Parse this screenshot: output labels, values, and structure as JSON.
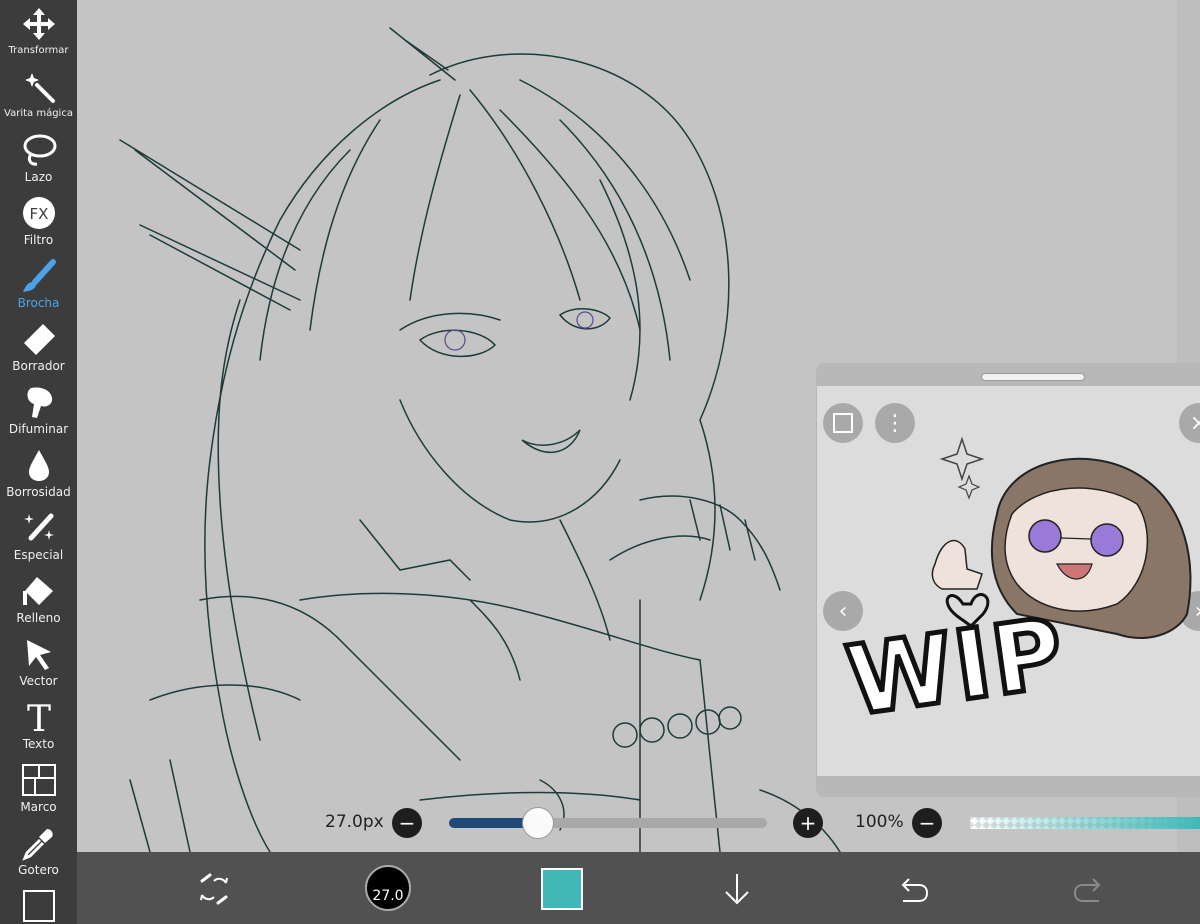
{
  "toolbar": {
    "tools": [
      {
        "label": "Transformar",
        "icon": "move-arrows-icon"
      },
      {
        "label": "Varita mágica",
        "icon": "magic-wand-icon"
      },
      {
        "label": "Lazo",
        "icon": "lasso-icon"
      },
      {
        "label": "Filtro",
        "icon": "fx-filter-icon"
      },
      {
        "label": "Brocha",
        "icon": "brush-icon",
        "active": true
      },
      {
        "label": "Borrador",
        "icon": "eraser-icon"
      },
      {
        "label": "Difuminar",
        "icon": "smudge-finger-icon"
      },
      {
        "label": "Borrosidad",
        "icon": "blur-drop-icon"
      },
      {
        "label": "Especial",
        "icon": "special-sparkle-brush-icon"
      },
      {
        "label": "Relleno",
        "icon": "fill-bucket-icon"
      },
      {
        "label": "Vector",
        "icon": "vector-cursor-icon"
      },
      {
        "label": "Texto",
        "icon": "text-t-icon"
      },
      {
        "label": "Marco",
        "icon": "frame-divider-icon"
      },
      {
        "label": "Gotero",
        "icon": "eyedropper-icon"
      },
      {
        "label": "",
        "icon": "canvas-icon"
      }
    ],
    "active_color": "#4aa3e8"
  },
  "brush": {
    "size_label": "27.0px",
    "size_fraction": 0.28,
    "opacity_label": "100%",
    "size_button_label": "27.0"
  },
  "colors": {
    "current": "#40b8b8",
    "slider_fill": "#1f4a78",
    "lineart": "#1e3a3a"
  },
  "reference": {
    "sticker_text": "WIP"
  },
  "bottombar": {
    "icons": [
      "brush-swap-icon",
      "brush-size-icon",
      "color-swatch",
      "layer-download-icon",
      "undo-icon",
      "redo-icon"
    ]
  }
}
